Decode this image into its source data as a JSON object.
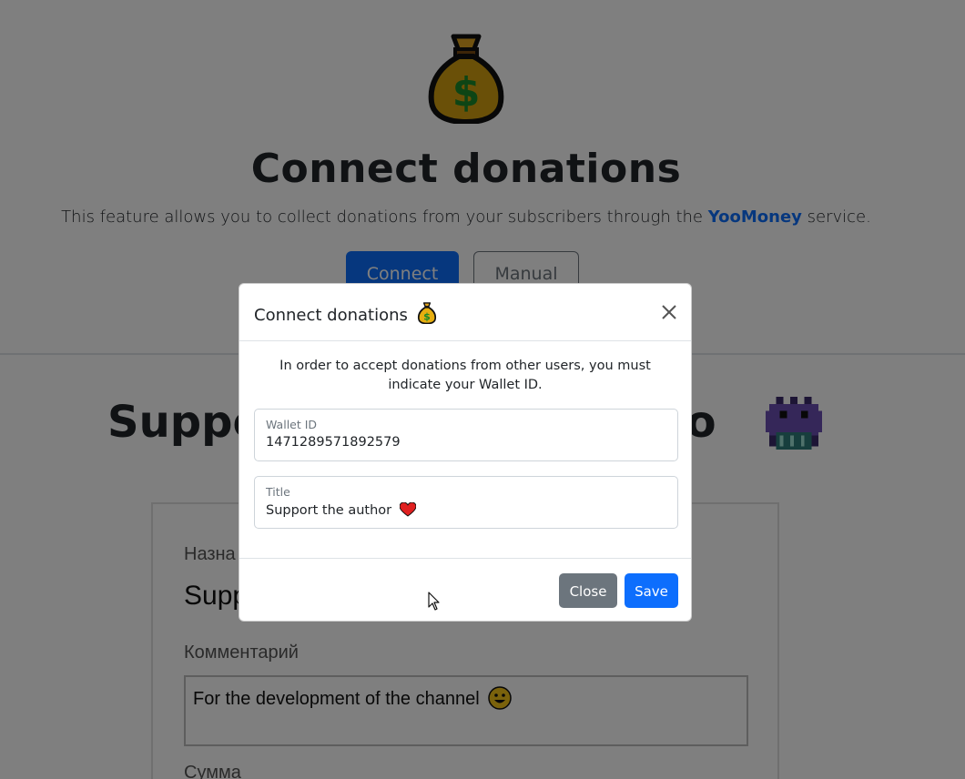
{
  "background": {
    "title": "Connect donations",
    "description_prefix": "This feature allows you to collect donations from your subscribers through the ",
    "description_link": "YooMoney",
    "description_suffix": " service.",
    "connect_label": "Connect",
    "manual_label": "Manual",
    "support_title": "Support the author, Kasko",
    "support_title_visible_left": "Suppo",
    "support_title_visible_right": "ko",
    "form": {
      "purpose_label": "Назна",
      "purpose_value": "Supp",
      "comment_label": "Комментарий",
      "comment_value": "For the development of the channel",
      "amount_label": "Сумма"
    }
  },
  "modal": {
    "title": "Connect donations",
    "body_text": "In order to accept donations from other users, you must indicate your Wallet ID.",
    "wallet_field": {
      "label": "Wallet ID",
      "value": "1471289571892579"
    },
    "title_field": {
      "label": "Title",
      "value": "Support the author"
    },
    "close_label": "Close",
    "save_label": "Save"
  },
  "icons": {
    "hero": "money-bag-icon",
    "title_emoji": "money-bag-icon",
    "heart": "red-heart-icon",
    "monster": "pixel-monster-icon",
    "smile": "grinning-face-icon",
    "close": "close-icon"
  },
  "colors": {
    "primary": "#0d6efd",
    "secondary": "#6c757d",
    "backdrop": "rgba(0,0,0,0.5)"
  }
}
